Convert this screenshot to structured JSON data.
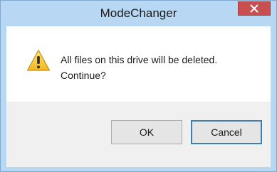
{
  "window": {
    "title": "ModeChanger",
    "close_icon": "close-icon"
  },
  "dialog": {
    "icon": "warning-icon",
    "message_line1": "All files on this drive will be deleted.",
    "message_line2": "Continue?"
  },
  "buttons": {
    "ok_label": "OK",
    "cancel_label": "Cancel"
  },
  "colors": {
    "frame": "#b8d7f2",
    "close": "#c74f4f",
    "accent": "#3c7fb1"
  }
}
